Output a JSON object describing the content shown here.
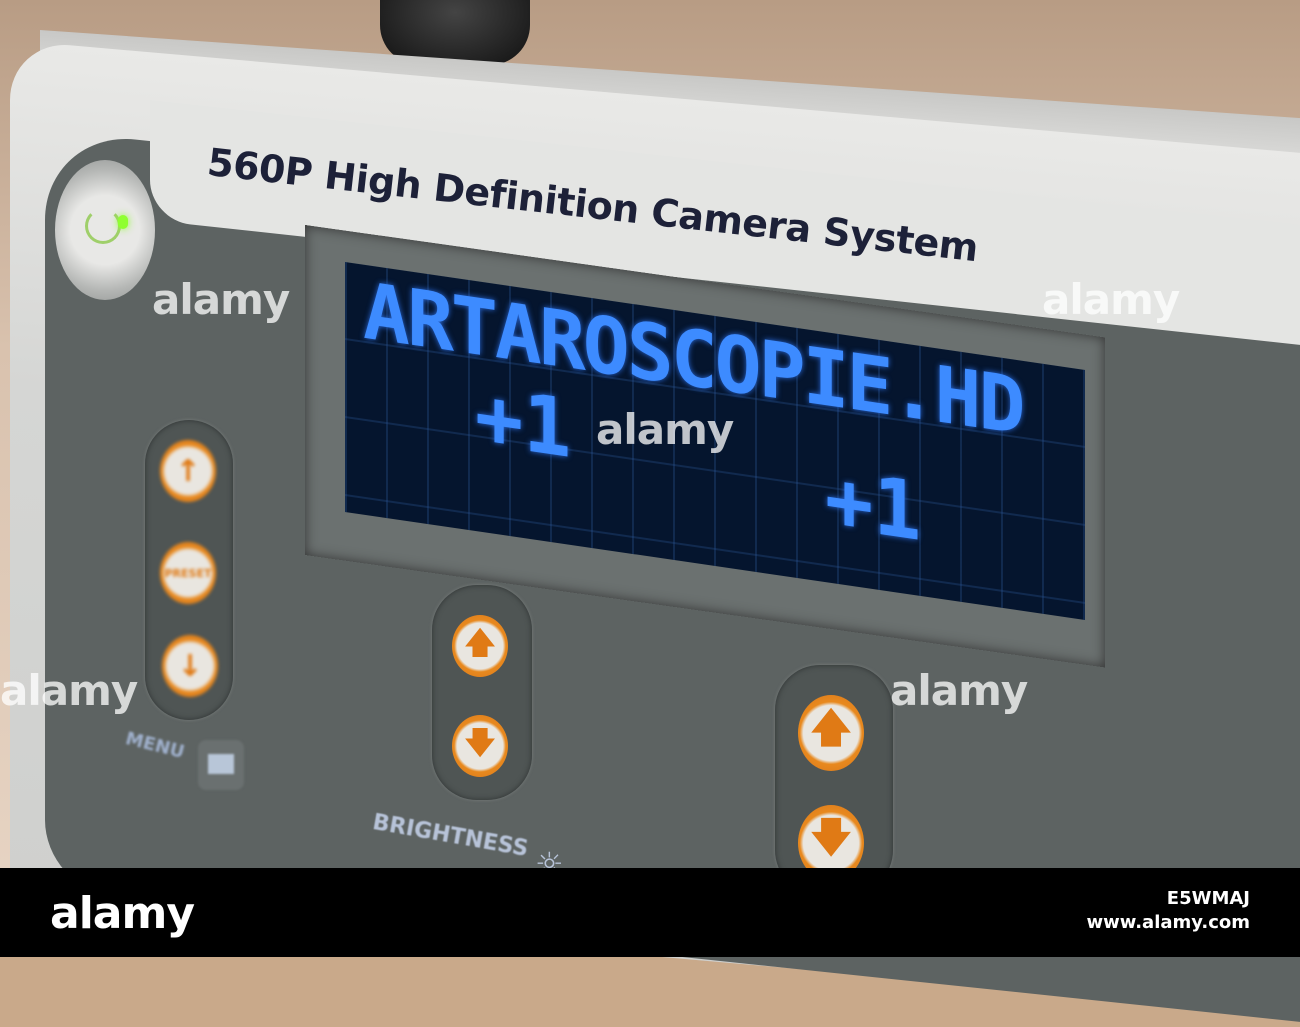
{
  "device": {
    "title": "560P High Definition Camera System",
    "display": {
      "line1": "ARTAROSCOPIE.HD",
      "value_left": "+1",
      "value_right": "+1",
      "text_color": "#3d8bff"
    },
    "controls": {
      "preset_button": "PRESET",
      "menu_label": "MENU",
      "brightness_label": "BRIGHTNESS",
      "accent_color": "#e8891e"
    }
  },
  "watermark": {
    "text": "alamy",
    "image_id": "E5WMAJ",
    "url": "www.alamy.com"
  }
}
